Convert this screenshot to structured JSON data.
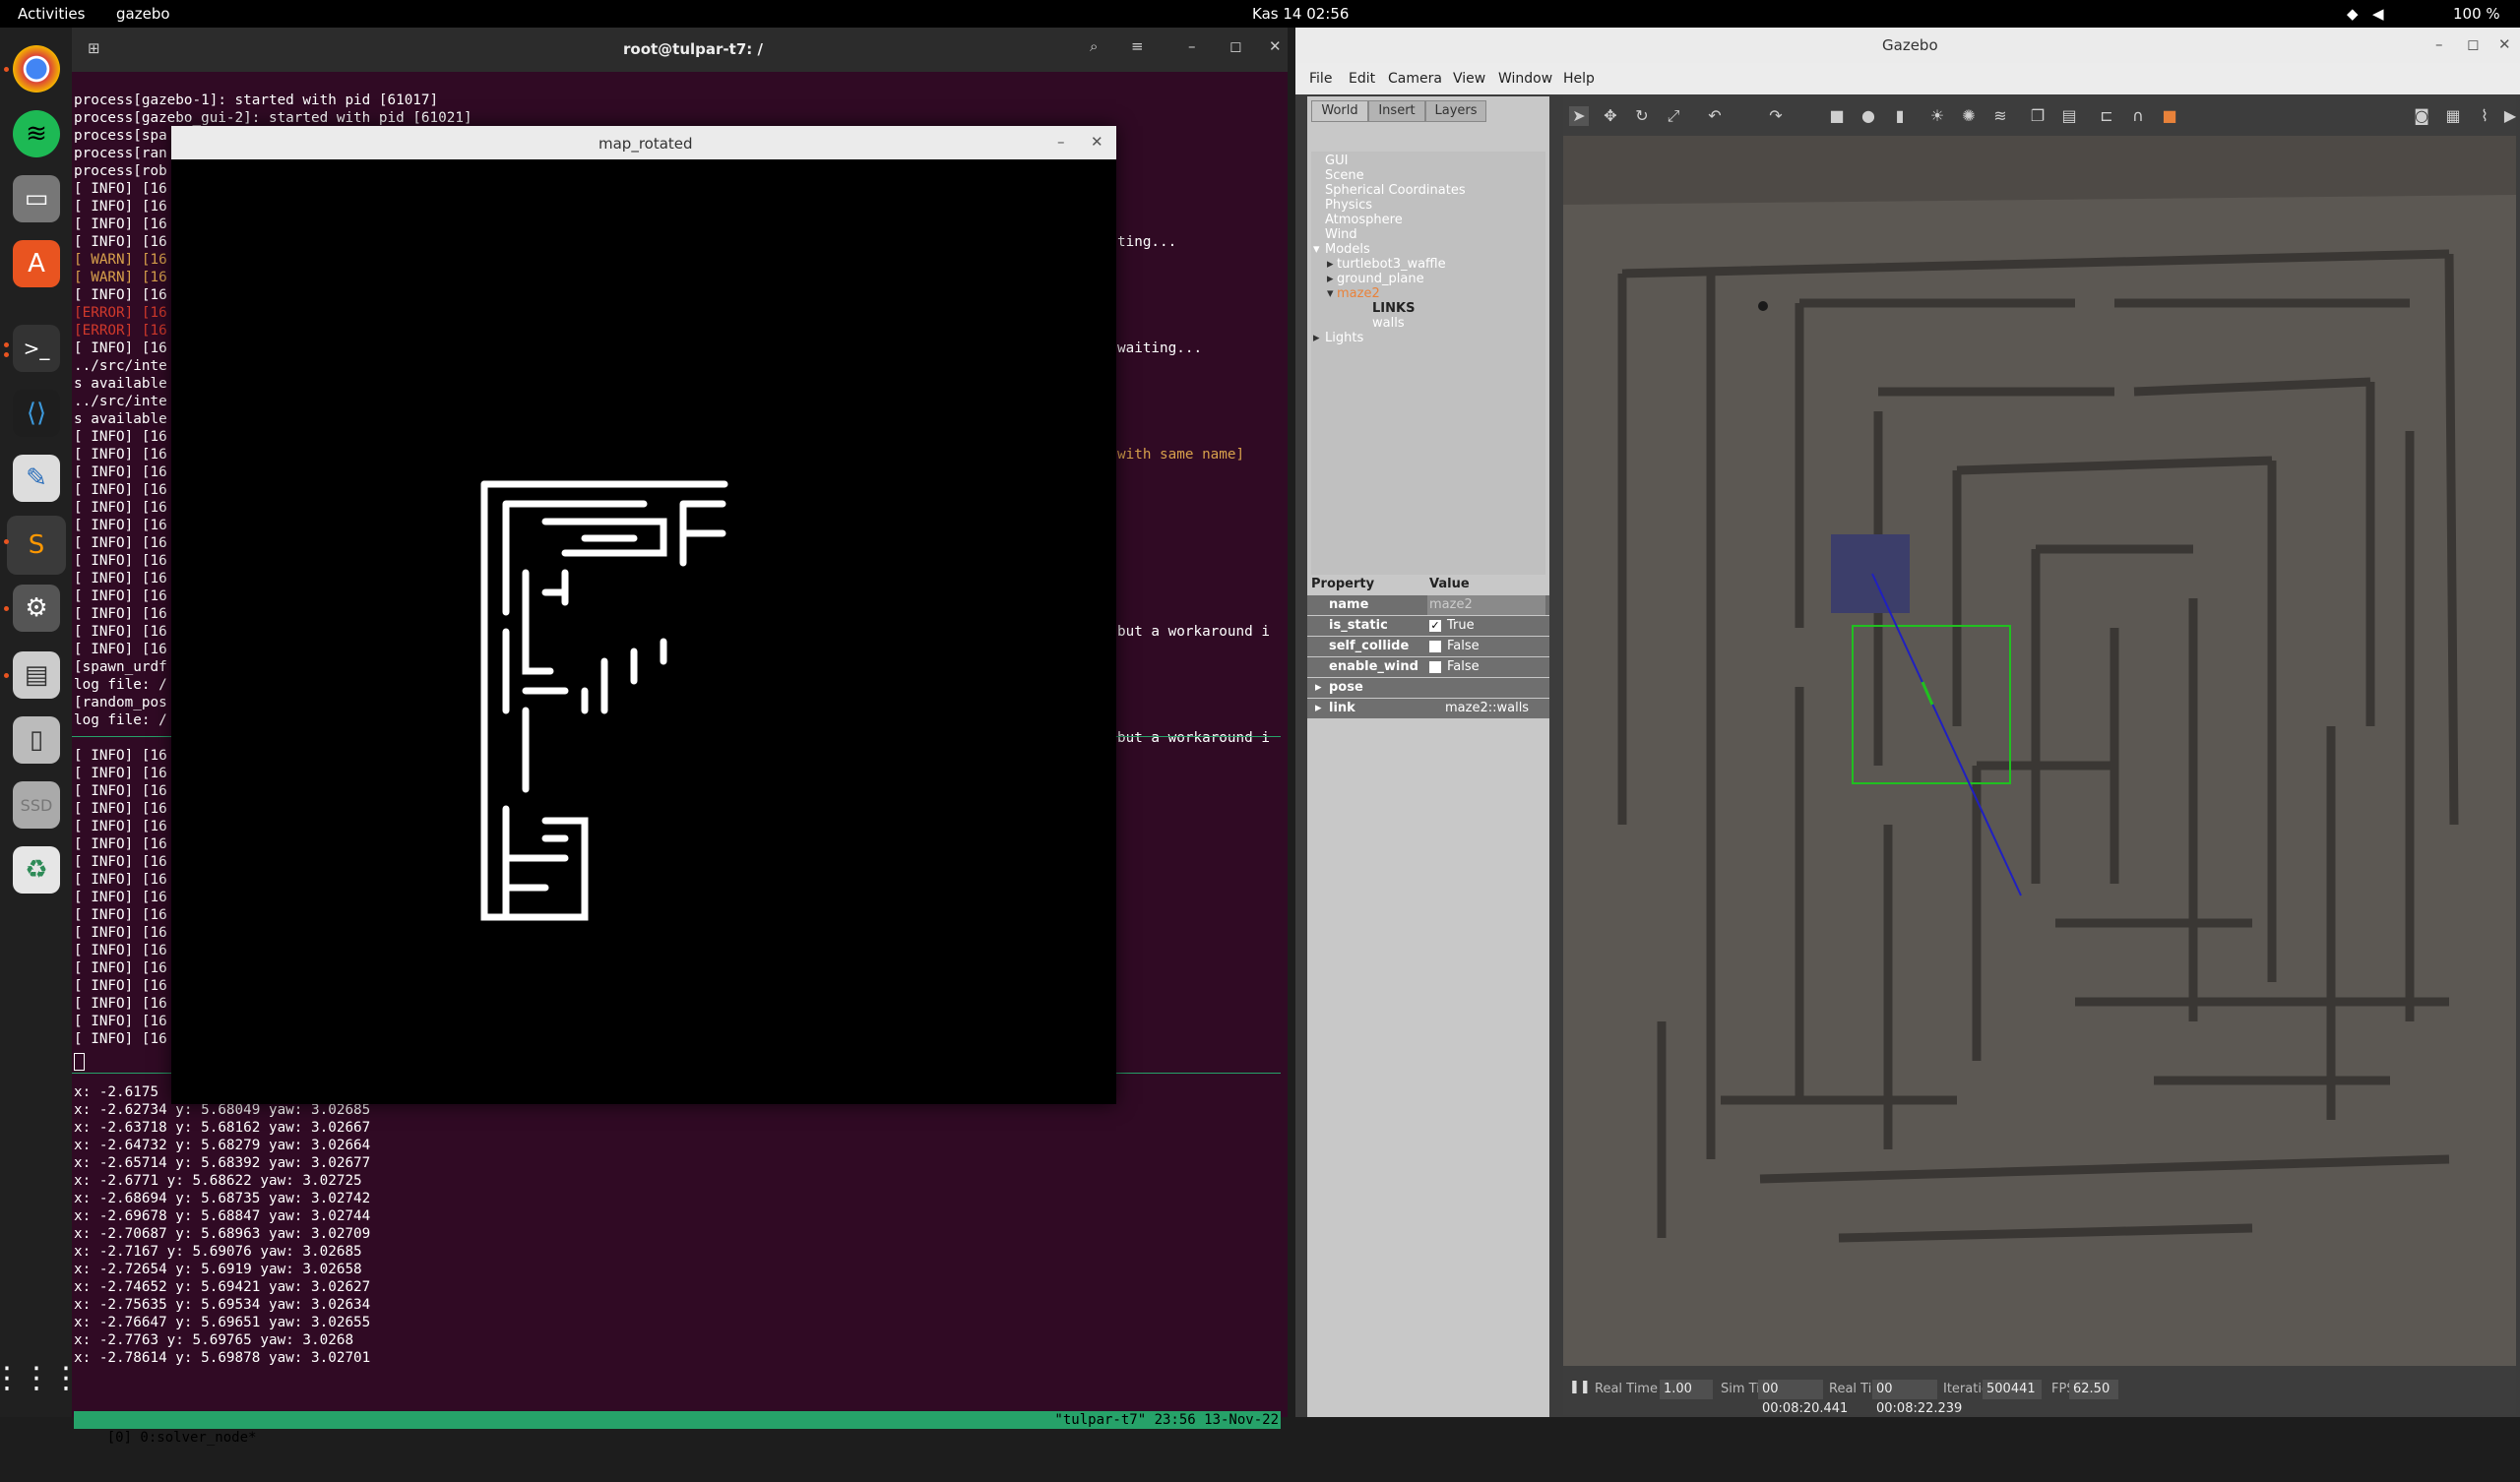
{
  "topbar": {
    "activities": "Activities",
    "app": "gazebo",
    "clock": "Kas 14  02:56",
    "battery": "100 %"
  },
  "dock": {
    "icons": [
      "chrome-icon",
      "spotify-icon",
      "files-icon",
      "software-icon",
      "terminal-icon",
      "vscode-icon",
      "text-editor-icon",
      "sublime-icon",
      "settings-icon",
      "document-viewer-icon",
      "drive-icon",
      "ssd-icon",
      "trash-icon",
      "app-grid-icon"
    ]
  },
  "terminal": {
    "title": "root@tulpar-t7: /",
    "pane1": [
      "process[gazebo-1]: started with pid [61017]",
      "process[gazebo_gui-2]: started with pid [61021]",
      "process[spa",
      "process[ran",
      "process[rob",
      "[ INFO] [16",
      "[ INFO] [16",
      "[ INFO] [16",
      "[ INFO] [16",
      "[ WARN] [16",
      "[ WARN] [16",
      "[ INFO] [16",
      "[ERROR] [16",
      "[ERROR] [16",
      "[ INFO] [16",
      "../src/inte",
      "s available",
      "../src/inte",
      "s available",
      "[ INFO] [16",
      "[ INFO] [16",
      "[ INFO] [16",
      "[ INFO] [16",
      "[ INFO] [16",
      "[ INFO] [16",
      "[ INFO] [16",
      "[ INFO] [16",
      "[ INFO] [16",
      "[ INFO] [16",
      "[ INFO] [16",
      "[ INFO] [16",
      "[ INFO] [16",
      "[spawn_urdf",
      "log file: /",
      "[random_pos",
      "log file: /"
    ],
    "pane1_right": [
      "ting...",
      "waiting...",
      "with same name]",
      "but a workaround i",
      "but a workaround i"
    ],
    "pane2": [
      "[ INFO] [16",
      "[ INFO] [16",
      "[ INFO] [16",
      "[ INFO] [16",
      "[ INFO] [16",
      "[ INFO] [16",
      "[ INFO] [16",
      "[ INFO] [16",
      "[ INFO] [16",
      "[ INFO] [16",
      "[ INFO] [16",
      "[ INFO] [16",
      "[ INFO] [16",
      "[ INFO] [16",
      "[ INFO] [16",
      "[ INFO] [16",
      "[ INFO] [16"
    ],
    "pane3": [
      "x: -2.6175",
      "x: -2.62734 y: 5.68049 yaw: 3.02685",
      "x: -2.63718 y: 5.68162 yaw: 3.02667",
      "x: -2.64732 y: 5.68279 yaw: 3.02664",
      "x: -2.65714 y: 5.68392 yaw: 3.02677",
      "x: -2.6771 y: 5.68622 yaw: 3.02725",
      "x: -2.68694 y: 5.68735 yaw: 3.02742",
      "x: -2.69678 y: 5.68847 yaw: 3.02744",
      "x: -2.70687 y: 5.68963 yaw: 3.02709",
      "x: -2.7167 y: 5.69076 yaw: 3.02685",
      "x: -2.72654 y: 5.6919 yaw: 3.02658",
      "x: -2.74652 y: 5.69421 yaw: 3.02627",
      "x: -2.75635 y: 5.69534 yaw: 3.02634",
      "x: -2.76647 y: 5.69651 yaw: 3.02655",
      "x: -2.7763 y: 5.69765 yaw: 3.0268",
      "x: -2.78614 y: 5.69878 yaw: 3.02701"
    ],
    "tmux_left": "[0] 0:solver_node*",
    "tmux_right": "\"tulpar-t7\" 23:56 13-Nov-22"
  },
  "map_window": {
    "title": "map_rotated"
  },
  "gazebo": {
    "title": "Gazebo",
    "menu": [
      "File",
      "Edit",
      "Camera",
      "View",
      "Window",
      "Help"
    ],
    "tabs": [
      "World",
      "Insert",
      "Layers"
    ],
    "tree": {
      "gui": "GUI",
      "scene": "Scene",
      "spherical": "Spherical Coordinates",
      "physics": "Physics",
      "atmosphere": "Atmosphere",
      "wind": "Wind",
      "models": "Models",
      "model1": "turtlebot3_waffle",
      "model2": "ground_plane",
      "model3": "maze2",
      "links": "LINKS",
      "walls": "walls",
      "lights": "Lights"
    },
    "props": {
      "header_property": "Property",
      "header_value": "Value",
      "name_k": "name",
      "name_v": "maze2",
      "static_k": "is_static",
      "static_v": "True",
      "collide_k": "self_collide",
      "collide_v": "False",
      "wind_k": "enable_wind",
      "wind_v": "False",
      "pose_k": "pose",
      "link_k": "link",
      "link_v": "maze2::walls"
    },
    "bottom": {
      "rtf_label": "Real Time Factor:",
      "rtf": "1.00",
      "sim_label": "Sim Time:",
      "sim": "00 00:08:20.441",
      "real_label": "Real Time:",
      "real": "00 00:08:22.239",
      "iter_label": "Iterations:",
      "iter": "500441",
      "fps_label": "FPS:",
      "fps": "62.50"
    }
  }
}
